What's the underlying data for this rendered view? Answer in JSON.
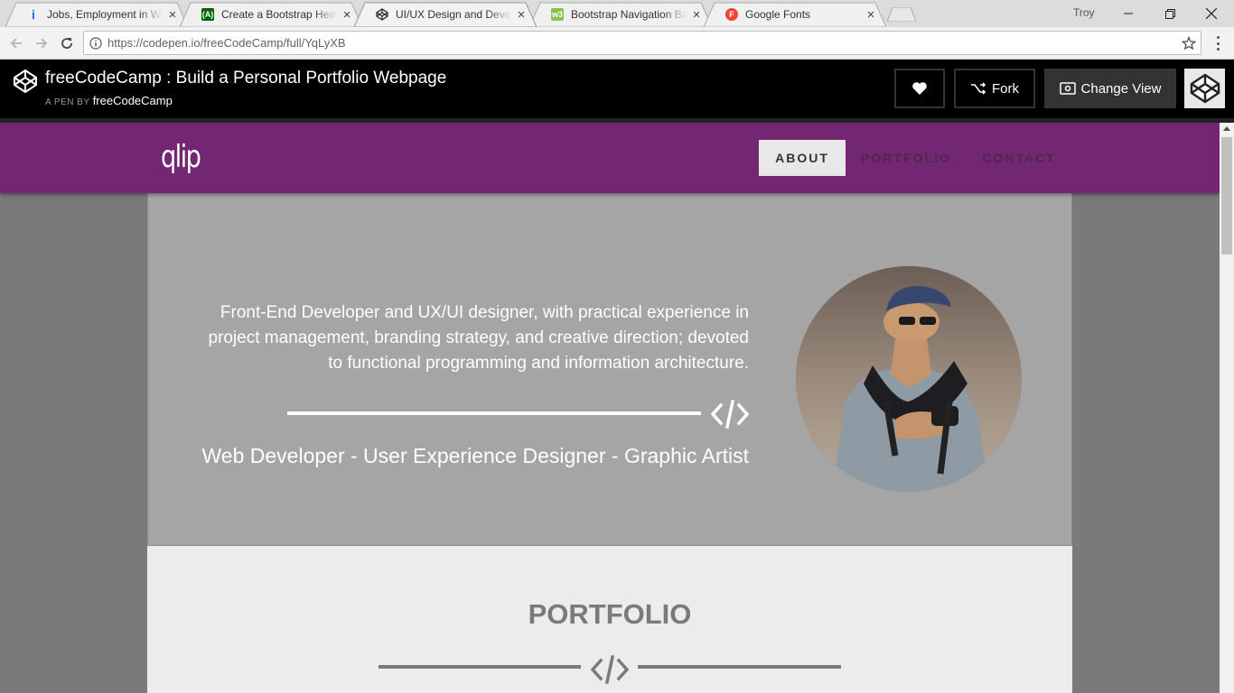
{
  "browser": {
    "tabs": [
      {
        "title": "Jobs, Employment in Wo",
        "favicon": "indeed-icon",
        "color": "#2164f3"
      },
      {
        "title": "Create a Bootstrap Head",
        "favicon": "freecodecamp-icon",
        "color": "#006400"
      },
      {
        "title": "UI/UX Design and Develo",
        "favicon": "codepen-icon",
        "color": "#000000",
        "active": true
      },
      {
        "title": "Bootstrap Navigation Bar",
        "favicon": "w3schools-icon",
        "color": "#8bc34a"
      },
      {
        "title": "Google Fonts",
        "favicon": "google-fonts-icon",
        "color": "#f44336"
      }
    ],
    "profile": "Troy",
    "url": "https://codepen.io/freeCodeCamp/full/YqLyXB"
  },
  "codepen": {
    "title": "freeCodeCamp : Build a Personal Portfolio Webpage",
    "by_prefix": "A PEN BY",
    "author": "freeCodeCamp",
    "fork_label": "Fork",
    "change_view_label": "Change View"
  },
  "site": {
    "brand": "qlip",
    "nav": [
      {
        "label": "ABOUT",
        "active": true
      },
      {
        "label": "PORTFOLIO",
        "active": false
      },
      {
        "label": "CONTACT",
        "active": false
      }
    ],
    "about_text": "Front-End Developer and UX/UI designer, with practical experience in project management, branding strategy, and creative direction; devoted to functional programming and information architecture.",
    "tagline": "Web Developer - User Experience Designer - Graphic Artist",
    "portfolio_title": "PORTFOLIO"
  },
  "colors": {
    "nav_purple": "#732672",
    "about_bg": "#a5a5a5",
    "portfolio_bg": "#ececec"
  }
}
